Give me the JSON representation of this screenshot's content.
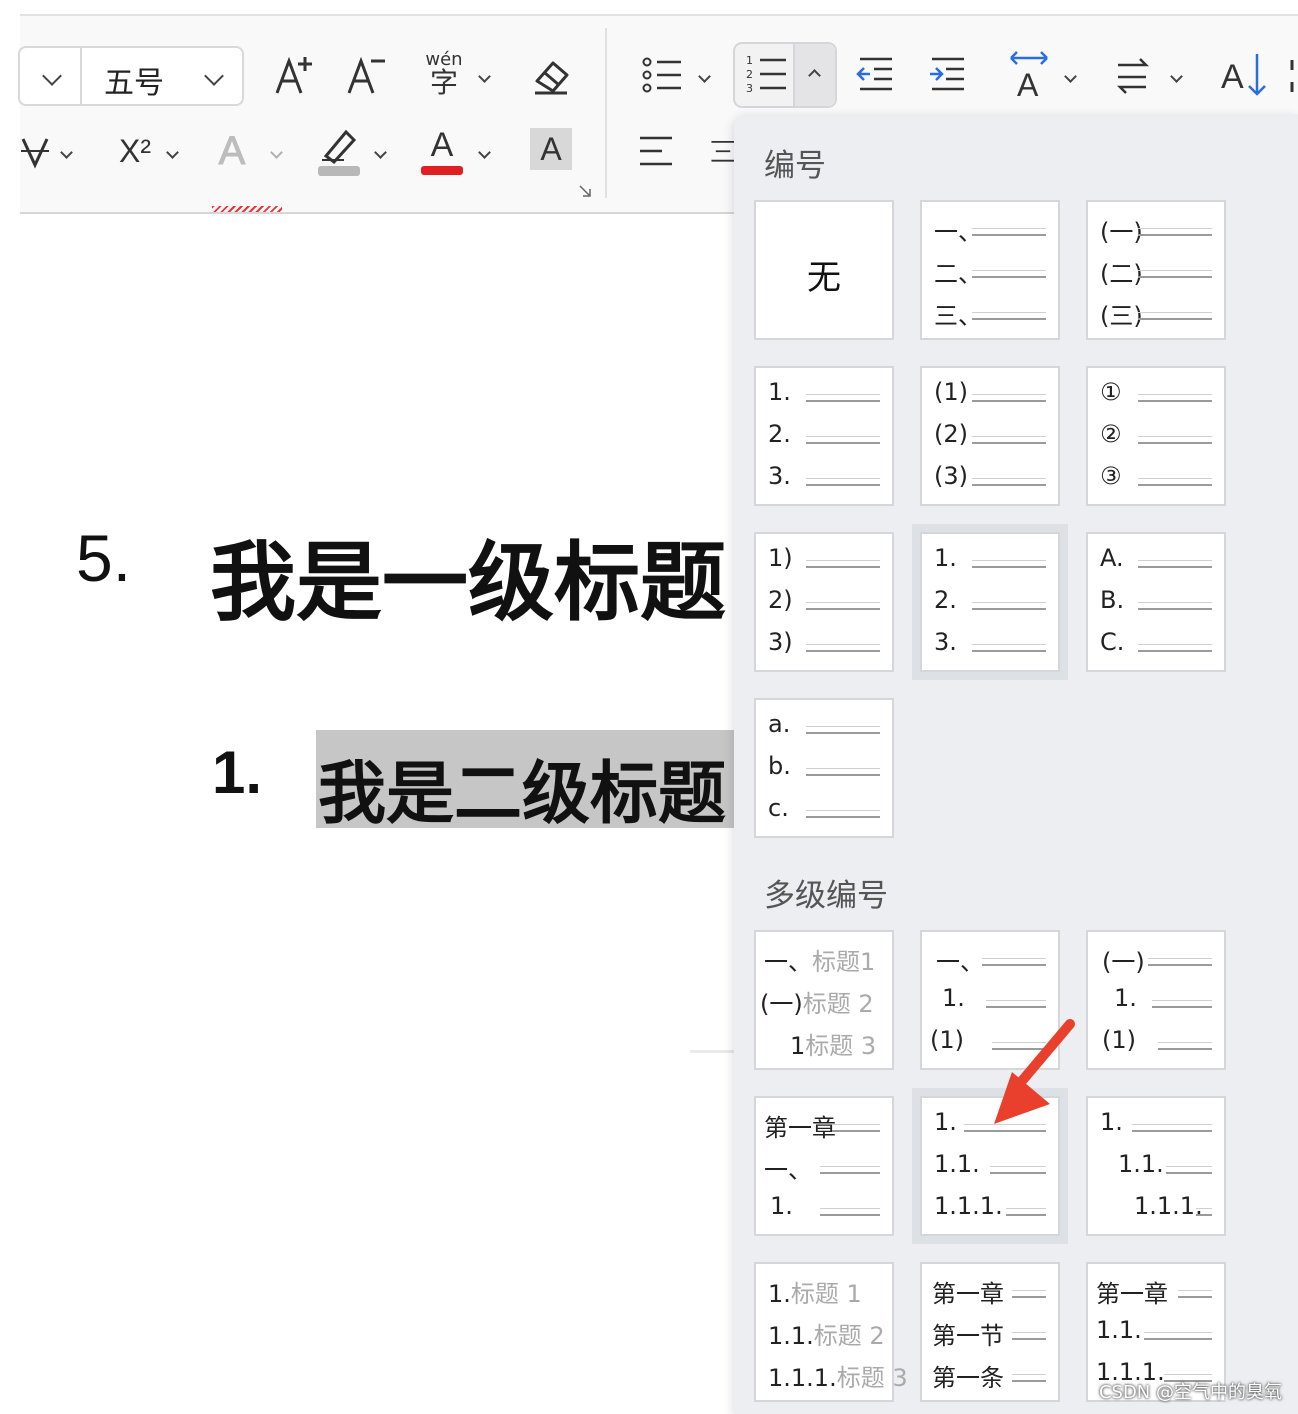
{
  "toolbar": {
    "font_size_value": "五号",
    "grow_font_icon": "font-grow-icon",
    "shrink_font_icon": "font-shrink-icon",
    "phonetic_label": "wén",
    "phonetic_char": "字",
    "clear_format_icon": "eraser-icon",
    "superscript_label": "X²",
    "text_effect_label": "A",
    "font_color_label": "A",
    "char_shading_label": "A",
    "font_color": "#e02020",
    "text_dir_label": "A",
    "sort_label": "A"
  },
  "document": {
    "h1_number": "5.",
    "h1_text": "我是一级标题",
    "h2_number": "1.",
    "h2_text": "我是二级标题"
  },
  "panel": {
    "numbering_title": "编号",
    "multilevel_title": "多级编号",
    "none_label": "无",
    "numbering_cards": [
      {
        "rows": [
          "一、",
          "二、",
          "三、"
        ]
      },
      {
        "rows": [
          "(一)",
          "(二)",
          "(三)"
        ]
      },
      {
        "rows": [
          "1.",
          "2.",
          "3."
        ]
      },
      {
        "rows": [
          "(1)",
          "(2)",
          "(3)"
        ]
      },
      {
        "rows": [
          "①",
          "②",
          "③"
        ]
      },
      {
        "rows": [
          "1)",
          "2)",
          "3)"
        ]
      },
      {
        "rows": [
          "1.",
          "2.",
          "3."
        ]
      },
      {
        "rows": [
          "A.",
          "B.",
          "C."
        ]
      },
      {
        "rows": [
          "a.",
          "b.",
          "c."
        ]
      }
    ],
    "multilevel_cards": [
      {
        "rows": [
          [
            "一、",
            "标题1"
          ],
          [
            "(一)",
            "标题 2"
          ],
          [
            "1",
            "标题 3"
          ]
        ]
      },
      {
        "rows": [
          [
            "一、",
            ""
          ],
          [
            "1.",
            ""
          ],
          [
            "(1)",
            ""
          ]
        ]
      },
      {
        "rows": [
          [
            "(一)",
            ""
          ],
          [
            "1.",
            ""
          ],
          [
            "(1)",
            ""
          ]
        ]
      },
      {
        "rows": [
          [
            "第一章",
            ""
          ],
          [
            "一、",
            ""
          ],
          [
            "1.",
            ""
          ]
        ]
      },
      {
        "rows": [
          [
            "1.",
            ""
          ],
          [
            "1.1.",
            ""
          ],
          [
            "1.1.1.",
            ""
          ]
        ]
      },
      {
        "rows": [
          [
            "1.",
            ""
          ],
          [
            "1.1.",
            ""
          ],
          [
            "1.1.1.",
            ""
          ]
        ]
      },
      {
        "rows": [
          [
            "1.",
            "标题 1"
          ],
          [
            "1.1.",
            "标题 2"
          ],
          [
            "1.1.1.",
            "标题 3"
          ]
        ]
      },
      {
        "rows": [
          [
            "第一章",
            ""
          ],
          [
            "第一节",
            ""
          ],
          [
            "第一条",
            ""
          ]
        ]
      },
      {
        "rows": [
          [
            "第一章",
            ""
          ],
          [
            "1.1.",
            ""
          ],
          [
            "1.1.1.",
            ""
          ]
        ]
      }
    ],
    "arrow_color": "#e8402c"
  },
  "watermark": "CSDN @空气中的臭氧"
}
